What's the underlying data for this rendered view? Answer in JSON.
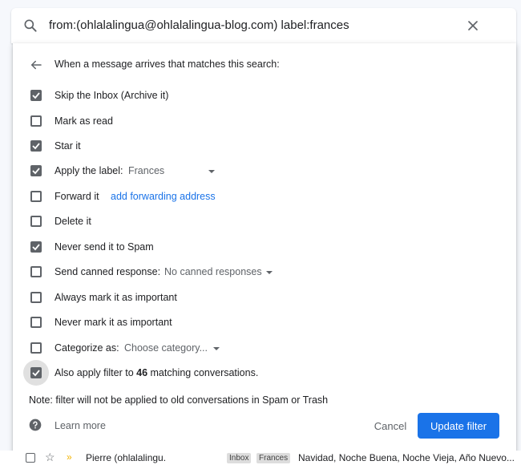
{
  "search": {
    "query": "from:(ohlalalingua@ohlalalingua-blog.com) label:frances"
  },
  "filter": {
    "header": "When a message arrives that matches this search:",
    "options": [
      {
        "label": "Skip the Inbox (Archive it)",
        "checked": true
      },
      {
        "label": "Mark as read",
        "checked": false
      },
      {
        "label": "Star it",
        "checked": true
      },
      {
        "label": "Apply the label:",
        "checked": true,
        "select_value": "Frances"
      },
      {
        "label": "Forward it",
        "checked": false,
        "link": "add forwarding address"
      },
      {
        "label": "Delete it",
        "checked": false
      },
      {
        "label": "Never send it to Spam",
        "checked": true
      },
      {
        "label": "Send canned response:",
        "checked": false,
        "select_value": "No canned responses"
      },
      {
        "label": "Always mark it as important",
        "checked": false
      },
      {
        "label": "Never mark it as important",
        "checked": false
      },
      {
        "label": "Categorize as:",
        "checked": false,
        "select_value": "Choose category..."
      },
      {
        "label_prefix": "Also apply filter to ",
        "count": "46",
        "label_suffix": " matching conversations.",
        "checked": true
      }
    ],
    "note": "Note: filter will not be applied to old conversations in Spam or Trash",
    "learn_more": "Learn more",
    "cancel_label": "Cancel",
    "update_label": "Update filter"
  },
  "list_row": {
    "sender": "Pierre (ohlalalingu.",
    "labels": [
      "Inbox",
      "Frances"
    ],
    "subject": "Navidad, Noche Buena, Noche Vieja, Año Nuevo..."
  },
  "colors": {
    "accent": "#1a73e8",
    "checkbox": "#5f6368",
    "important": "#f4b400"
  }
}
